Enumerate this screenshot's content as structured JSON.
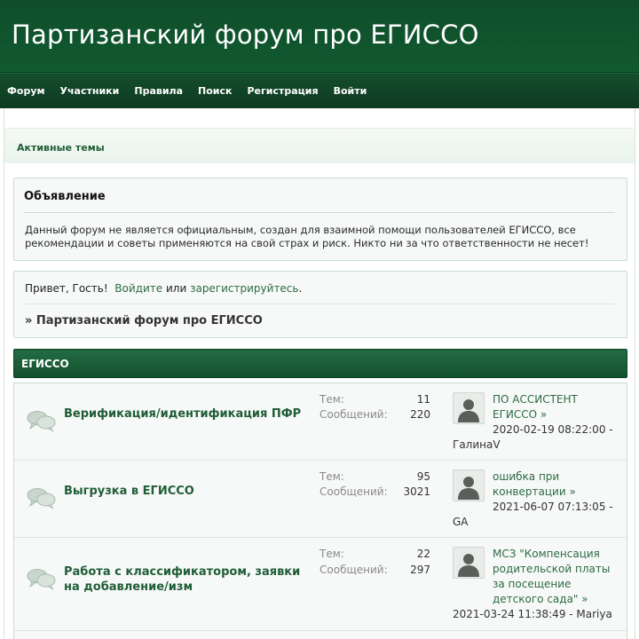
{
  "header": {
    "title": "Партизанский форум про ЕГИССО"
  },
  "nav": {
    "items": [
      {
        "label": "Форум"
      },
      {
        "label": "Участники"
      },
      {
        "label": "Правила"
      },
      {
        "label": "Поиск"
      },
      {
        "label": "Регистрация"
      },
      {
        "label": "Войти"
      }
    ]
  },
  "toplinks": {
    "active_topics": "Активные темы"
  },
  "announcement": {
    "title": "Объявление",
    "text": "Данный форум не является официальным, создан для взаимной помощи пользователей ЕГИССО, все рекомендации и советы применяются на свой страх и риск. Никто ни за что ответственности не несет!"
  },
  "welcome": {
    "greeting": "Привет, Гость!",
    "login": "Войдите",
    "or": "или",
    "register": "зарегистрируйтесь",
    "period": ".",
    "crumb": "» Партизанский форум про ЕГИССО"
  },
  "category": {
    "title": "ЕГИССО"
  },
  "stats_labels": {
    "topics": "Тем:",
    "posts": "Сообщений:"
  },
  "forums": [
    {
      "name": "Верификация/идентификация ПФР",
      "topics": "11",
      "posts": "220",
      "last_topic": "ПО АССИСТЕНТ ЕГИССО",
      "arrow": "»",
      "last_date": "2020-02-19 08:22:00 -",
      "last_user": "ГалинаV"
    },
    {
      "name": "Выгрузка в ЕГИССО",
      "topics": "95",
      "posts": "3021",
      "last_topic": "ошибка при конвертации",
      "arrow": "»",
      "last_date": "2021-06-07 07:13:05 -",
      "last_user": "GA"
    },
    {
      "name": "Работа с классификатором, заявки на добавление/изм",
      "topics": "22",
      "posts": "297",
      "last_topic": "МСЗ \"Компенсация родительской платы за посещение детского сада\"",
      "arrow": "»",
      "last_date": "2021-03-24 11:38:49 - Mariya",
      "last_user": ""
    }
  ],
  "colors": {
    "header_bg": "#0f4d2a",
    "nav_bg": "#0d3a20",
    "link": "#2e6a45",
    "forum_title": "#1f5d36"
  }
}
